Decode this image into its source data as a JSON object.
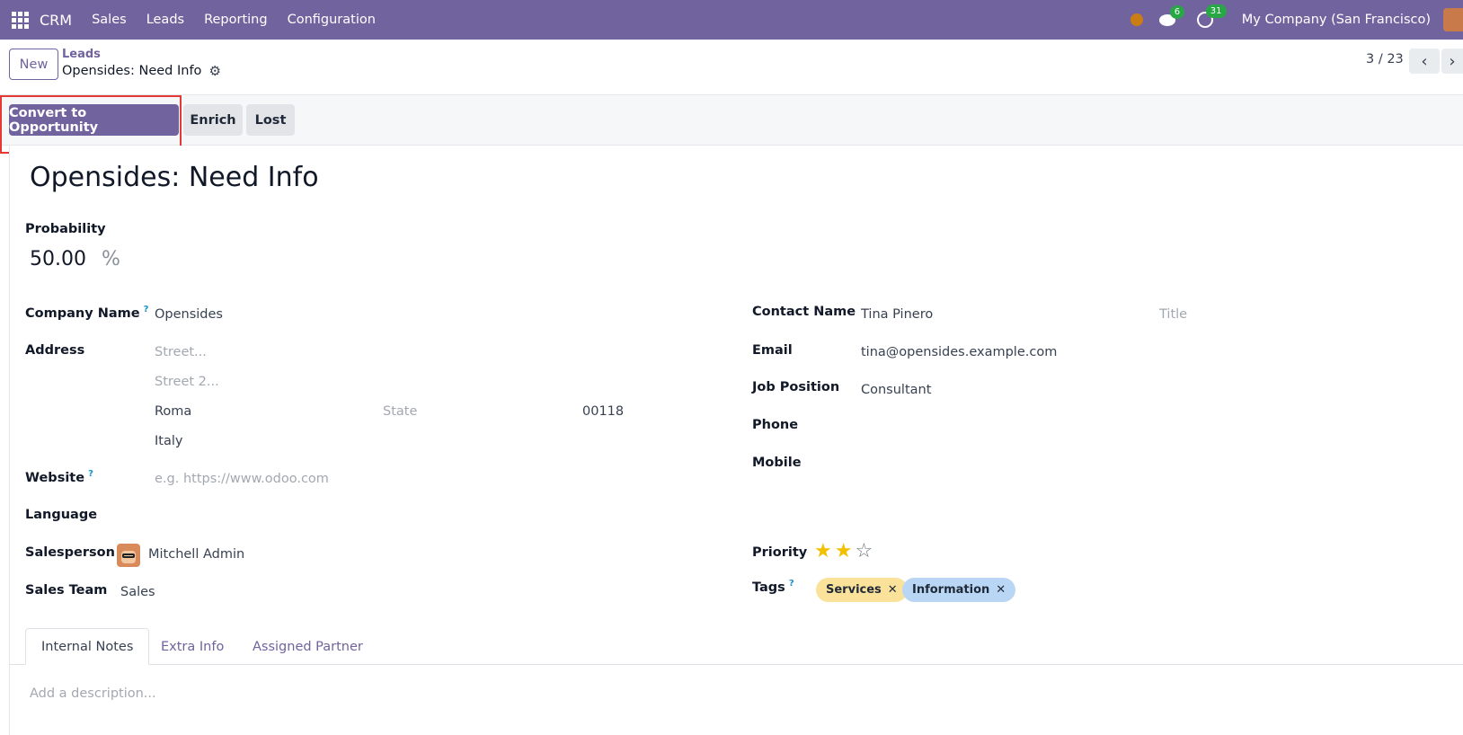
{
  "navbar": {
    "brand": "CRM",
    "menu": [
      "Sales",
      "Leads",
      "Reporting",
      "Configuration"
    ],
    "messages_count": "6",
    "activities_count": "31",
    "company": "My Company (San Francisco)",
    "accent_color": "#71639e"
  },
  "control_panel": {
    "new_label": "New",
    "breadcrumb_parent": "Leads",
    "breadcrumb_current": "Opensides: Need Info",
    "pager": "3 / 23"
  },
  "statusbar": {
    "convert_label": "Convert to Opportunity",
    "enrich_label": "Enrich",
    "lost_label": "Lost"
  },
  "form": {
    "title": "Opensides: Need Info",
    "probability_label": "Probability",
    "probability_value": "50.00",
    "probability_unit": "%",
    "company_name_label": "Company Name",
    "company_name_value": "Opensides",
    "address_label": "Address",
    "street_placeholder": "Street...",
    "street2_placeholder": "Street 2...",
    "city": "Roma",
    "state_placeholder": "State",
    "zip": "00118",
    "country": "Italy",
    "website_label": "Website",
    "website_placeholder": "e.g. https://www.odoo.com",
    "language_label": "Language",
    "salesperson_label": "Salesperson",
    "salesperson_value": "Mitchell Admin",
    "sales_team_label": "Sales Team",
    "sales_team_value": "Sales",
    "contact_name_label": "Contact Name",
    "contact_name_value": "Tina Pinero",
    "title_placeholder": "Title",
    "email_label": "Email",
    "email_value": "tina@opensides.example.com",
    "job_position_label": "Job Position",
    "job_position_value": "Consultant",
    "phone_label": "Phone",
    "mobile_label": "Mobile",
    "priority_label": "Priority",
    "priority_value": 2,
    "priority_max": 3,
    "tags_label": "Tags",
    "tags": [
      {
        "label": "Services",
        "color": "#fbe29b"
      },
      {
        "label": "Information",
        "color": "#b9d7f5"
      }
    ],
    "help_mark": "?"
  },
  "tabs": {
    "items": [
      "Internal Notes",
      "Extra Info",
      "Assigned Partner"
    ],
    "active": "Internal Notes"
  },
  "notes": {
    "placeholder": "Add a description..."
  }
}
